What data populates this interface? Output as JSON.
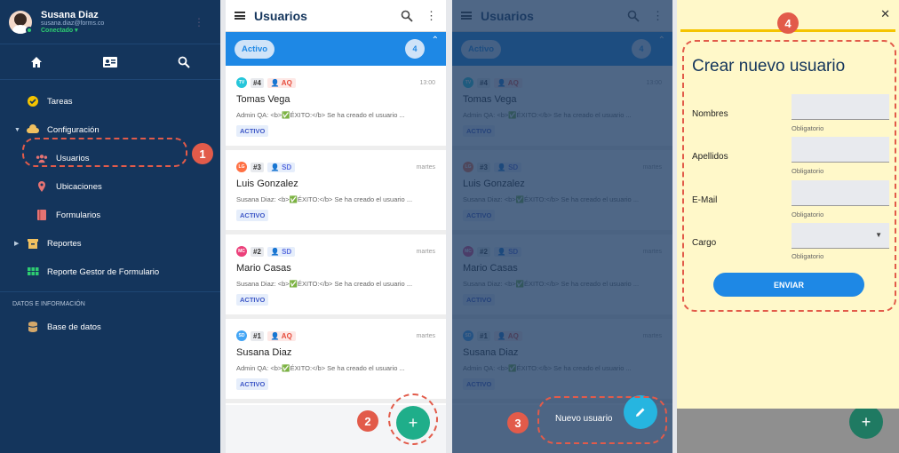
{
  "sidebar": {
    "user_name": "Susana Diaz",
    "user_email": "susana.diaz@forms.co",
    "user_status": "Conectado",
    "items": [
      {
        "label": "Tareas"
      },
      {
        "label": "Configuración"
      },
      {
        "label": "Usuarios"
      },
      {
        "label": "Ubicaciones"
      },
      {
        "label": "Formularios"
      },
      {
        "label": "Reportes"
      },
      {
        "label": "Reporte Gestor de Formulario"
      }
    ],
    "section_title": "DATOS E INFORMACIÓN",
    "db_label": "Base de datos"
  },
  "list": {
    "title": "Usuarios",
    "filter_label": "Activo",
    "count": "4",
    "records": [
      {
        "initials": "TV",
        "color": "#26c6da",
        "number": "#4",
        "tag": "AQ",
        "time": "13:00",
        "name": "Tomas Vega",
        "message": "Admin QA: <b>✅ÉXITO:</b> Se ha creado el usuario ...",
        "status": "ACTIVO"
      },
      {
        "initials": "LG",
        "color": "#ff7043",
        "number": "#3",
        "tag": "SD",
        "time": "martes",
        "name": "Luis Gonzalez",
        "message": "Susana Diaz: <b>✅ÉXITO:</b> Se ha creado el usuario ...",
        "status": "ACTIVO"
      },
      {
        "initials": "MC",
        "color": "#ec407a",
        "number": "#2",
        "tag": "SD",
        "time": "martes",
        "name": "Mario Casas",
        "message": "Susana Diaz: <b>✅ÉXITO:</b> Se ha creado el usuario ...",
        "status": "ACTIVO"
      },
      {
        "initials": "SD",
        "color": "#42a5f5",
        "number": "#1",
        "tag": "AQ",
        "time": "martes",
        "name": "Susana Diaz",
        "message": "Admin QA: <b>✅ÉXITO:</b> Se ha creado el usuario ...",
        "status": "ACTIVO"
      }
    ]
  },
  "fab_menu": {
    "new_user_label": "Nuevo usuario"
  },
  "form": {
    "title": "Crear nuevo usuario",
    "fields": [
      {
        "label": "Nombres",
        "help": "Obligatorio"
      },
      {
        "label": "Apellidos",
        "help": "Obligatorio"
      },
      {
        "label": "E-Mail",
        "help": "Obligatorio"
      },
      {
        "label": "Cargo",
        "help": "Obligatorio"
      }
    ],
    "submit_label": "ENVIAR"
  },
  "callouts": [
    "1",
    "2",
    "3",
    "4"
  ],
  "colors": {
    "sidebar": "#14355c",
    "accent": "#1e88e5",
    "fab": "#1fae8a",
    "callout": "#e25b4a",
    "form_bg": "#fff8c9"
  }
}
